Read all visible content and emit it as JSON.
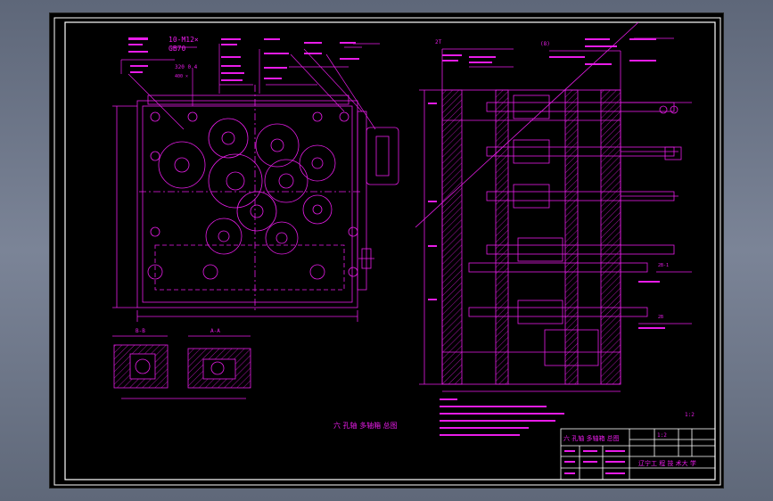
{
  "colors": {
    "background": "#000000",
    "linework": "#e81ce8",
    "frame": "#ffffff",
    "chrome": "#6f788b"
  },
  "left_view": {
    "callouts": {
      "bolt_spec": "10-M12×",
      "bolt_std": "GB70",
      "tolerance_a": "320 0.4",
      "tolerance_b": "400 ×"
    }
  },
  "right_view": {
    "callouts": {
      "top_left": "2T",
      "top_mid": "(8)",
      "top_right": "1:2",
      "side_a": "2B-1",
      "side_b": "2B"
    }
  },
  "section_views": {
    "label_b": "B-B",
    "label_a": "A-A"
  },
  "drawing_title": "六 孔轴 多轴箱 总图",
  "title_block": {
    "title": "六 孔轴 多轴箱 总图",
    "school": "辽宁工 程 技 术大 学",
    "scale": "1:2"
  }
}
